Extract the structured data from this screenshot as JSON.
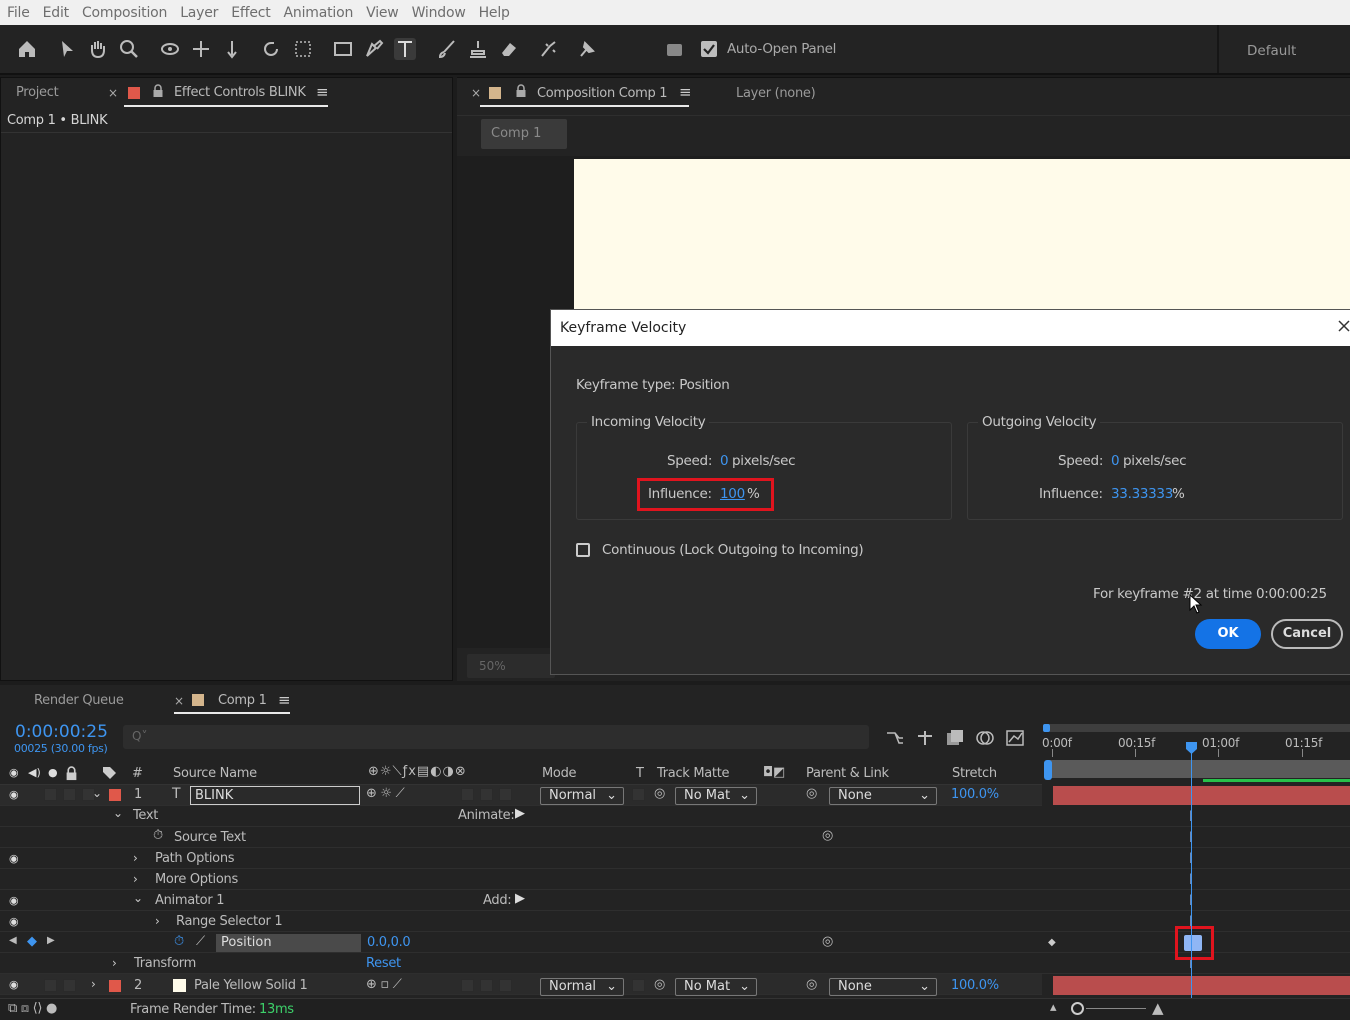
{
  "menu": [
    "File",
    "Edit",
    "Composition",
    "Layer",
    "Effect",
    "Animation",
    "View",
    "Window",
    "Help"
  ],
  "toolbar": {
    "tool_icons": [
      "home-icon",
      "selection-tool-icon",
      "hand-tool-icon",
      "zoom-tool-icon",
      "orbit-camera-icon",
      "pan-camera-icon",
      "dolly-camera-icon",
      "rotation-tool-icon",
      "pan-behind-icon",
      "rectangle-tool-icon",
      "pen-tool-icon",
      "type-tool-icon",
      "brush-tool-icon",
      "clone-stamp-icon",
      "eraser-tool-icon",
      "roto-brush-icon",
      "puppet-pin-icon"
    ],
    "auto_open_label": "Auto-Open Panel",
    "workspace": "Default"
  },
  "left_panel": {
    "tab_project": "Project",
    "tab_effect_controls": "Effect Controls BLINK",
    "breadcrumb": "Comp 1 • BLINK"
  },
  "viewer": {
    "tab_composition": "Composition Comp 1",
    "tab_layer": "Layer (none)",
    "comp_chip": "Comp 1",
    "zoom": "50%"
  },
  "dialog": {
    "title": "Keyframe Velocity",
    "keyframe_type": "Keyframe type: Position",
    "incoming": {
      "heading": "Incoming Velocity",
      "speed_label": "Speed:",
      "speed_value": "0",
      "speed_unit": "pixels/sec",
      "influence_label": "Influence:",
      "influence_value": "100",
      "influence_unit": "%"
    },
    "outgoing": {
      "heading": "Outgoing Velocity",
      "speed_label": "Speed:",
      "speed_value": "0",
      "speed_unit": "pixels/sec",
      "influence_label": "Influence:",
      "influence_value": "33.33333",
      "influence_unit": "%"
    },
    "continuous_label": "Continuous (Lock Outgoing to Incoming)",
    "keyframe_info": "For keyframe #2 at time 0:00:00:25",
    "ok": "OK",
    "cancel": "Cancel"
  },
  "timeline": {
    "tab_render_queue": "Render Queue",
    "tab_comp": "Comp 1",
    "timecode": "0:00:00:25",
    "frames_fps": "00025 (30.00 fps)",
    "search_placeholder": "Q˅",
    "ruler_labels": [
      "0:00f",
      "00:15f",
      "01:00f",
      "01:15f"
    ],
    "columns": {
      "hash": "#",
      "source_name": "Source Name",
      "mode": "Mode",
      "t": "T",
      "track_matte": "Track Matte",
      "parent_link": "Parent & Link",
      "stretch": "Stretch"
    },
    "rows": {
      "layer1": {
        "num": "1",
        "name": "BLINK",
        "mode": "Normal",
        "matte": "No Mat",
        "parent": "None",
        "stretch": "100.0%",
        "color": "#e0584a"
      },
      "text": "Text",
      "animate_label": "Animate:",
      "source_text": "Source Text",
      "path_options": "Path Options",
      "more_options": "More Options",
      "animator": "Animator 1",
      "add_label": "Add:",
      "range_selector": "Range Selector 1",
      "position_label": "Position",
      "position_value": "0.0,0.0",
      "transform": "Transform",
      "reset": "Reset",
      "layer2": {
        "num": "2",
        "name": "Pale Yellow Solid 1",
        "mode": "Normal",
        "matte": "No Mat",
        "parent": "None",
        "stretch": "100.0%",
        "color": "#e0584a"
      }
    },
    "footer": {
      "render_time_label": "Frame Render Time:",
      "render_time_value": "13ms"
    }
  },
  "colors": {
    "accent_blue": "#3e95f0",
    "highlight_red": "#e0141e",
    "layer_bar": "#b94d4d",
    "comp_bg": "#fffbea"
  }
}
